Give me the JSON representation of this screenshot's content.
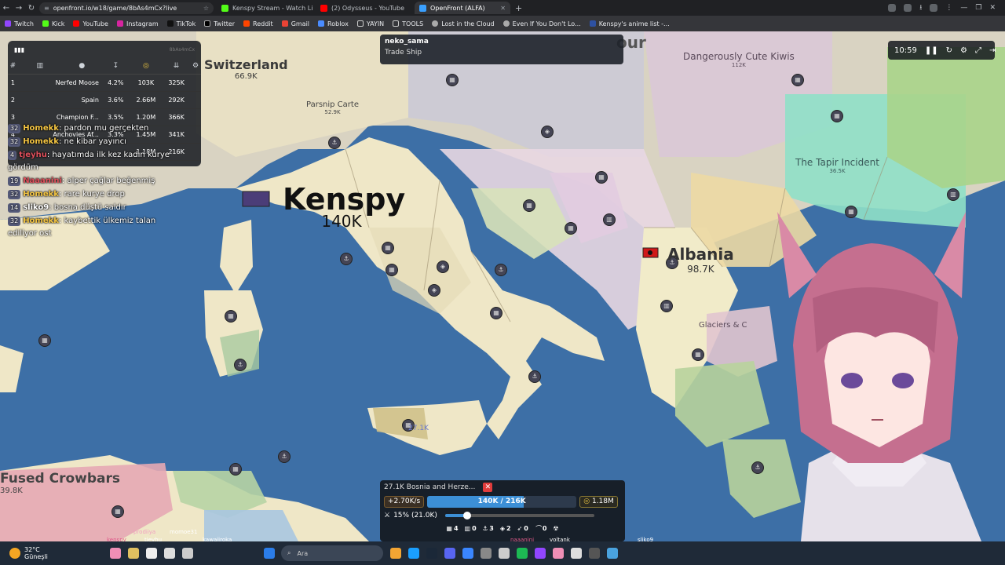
{
  "browser": {
    "url": "openfront.io/w18/game/8bAs4mCx?live",
    "tabs": [
      {
        "title": "Kenspy Stream - Watch Live",
        "color": "#53fc18"
      },
      {
        "title": "(2) Odysseus - YouTube",
        "color": "#ff0000"
      },
      {
        "title": "OpenFront (ALFA)",
        "color": "#3aa0ff"
      }
    ],
    "bookmarks": [
      "Twitch",
      "Kick",
      "YouTube",
      "Instagram",
      "TikTok",
      "Twitter",
      "Reddit",
      "Gmail",
      "Roblox",
      "YAYIN",
      "TOOLS",
      "Lost in the Cloud",
      "Even If You Don't Lo...",
      "Kenspy's anime list -..."
    ]
  },
  "leaderboard": {
    "brand": "8bAs4mCx",
    "rows": [
      {
        "rank": "1",
        "name": "Nerfed Moose",
        "pct": "4.2%",
        "gold": "103K",
        "troops": "325K"
      },
      {
        "rank": "2",
        "name": "Spain",
        "pct": "3.6%",
        "gold": "2.66M",
        "troops": "292K"
      },
      {
        "rank": "3",
        "name": "Champion F...",
        "pct": "3.5%",
        "gold": "1.20M",
        "troops": "366K"
      },
      {
        "rank": "4",
        "name": "Anchovies Af...",
        "pct": "3.3%",
        "gold": "1.45M",
        "troops": "341K"
      },
      {
        "rank": "",
        "name": "",
        "pct": "",
        "gold": "1.18M",
        "troops": "216K"
      }
    ]
  },
  "chat": [
    {
      "level": "32",
      "user": "Homekk",
      "user_color": "#f4c542",
      "text": "pardon mu gerçekten"
    },
    {
      "level": "32",
      "user": "Homekk",
      "user_color": "#f4c542",
      "text": "ne kibar yayıncı"
    },
    {
      "level": "4",
      "user": "tjeyhu",
      "user_color": "#e0505c",
      "text": "hayatımda ilk kez kadın kurye gördüm"
    },
    {
      "level": "19",
      "user": "Naaanini",
      "user_color": "#e0505c",
      "text": "alper çağlar beğenmiş"
    },
    {
      "level": "32",
      "user": "Homekk",
      "user_color": "#f4c542",
      "text": "rare kurye drop"
    },
    {
      "level": "14",
      "user": "sliko9",
      "user_color": "#ffffff",
      "text": "bosna düştü saldır"
    },
    {
      "level": "32",
      "user": "Homekk",
      "user_color": "#f4c542",
      "text": "kaybettik ülkemiz talan ediliyor ost"
    }
  ],
  "tooltip": {
    "owner": "neko_sama",
    "unit": "Trade Ship"
  },
  "timer": {
    "time": "10:59"
  },
  "map_labels": {
    "kenspy_name": "Kenspy",
    "kenspy_troops": "140K",
    "switzerland": "Switzerland",
    "switzerland_troops": "66.9K",
    "parsnip": "Parsnip Carte",
    "parsnip_troops": "52.9K",
    "kiwis": "Dangerously Cute Kiwis",
    "kiwis_troops": "112K",
    "tapir": "The Tapir Incident",
    "tapir_troops": "36.5K",
    "albania": "Albania",
    "albania_troops": "98.7K",
    "glaciers": "Glaciers & C",
    "crowbars": "Fused Crowbars",
    "crowbars_troops": "39.8K",
    "sicily_troops": "27.1K",
    "frag_our": "our"
  },
  "control_panel": {
    "selected": "27.1K  Bosnia and Herze...",
    "income": "+2.70K/s",
    "troops_text": "140K / 216K",
    "troops_fraction": 0.648,
    "gold": "1.18M",
    "attack_ratio": "15% (21.0K)",
    "attack_fraction": 0.15,
    "builds": [
      "4",
      "0",
      "3",
      "2",
      "0",
      "0"
    ]
  },
  "overlay_names": [
    "kenspy",
    "tjeyhu",
    "prodiiya",
    "momoe31",
    "kawaiiroka",
    "naaanini",
    "voltank",
    "sliko9"
  ],
  "taskbar": {
    "temp": "32°C",
    "condition": "Güneşli",
    "search": "Ara"
  },
  "colors": {
    "ocean": "#3d6fa6",
    "land": "#efe7c7",
    "accent": "#3c8fd6"
  }
}
